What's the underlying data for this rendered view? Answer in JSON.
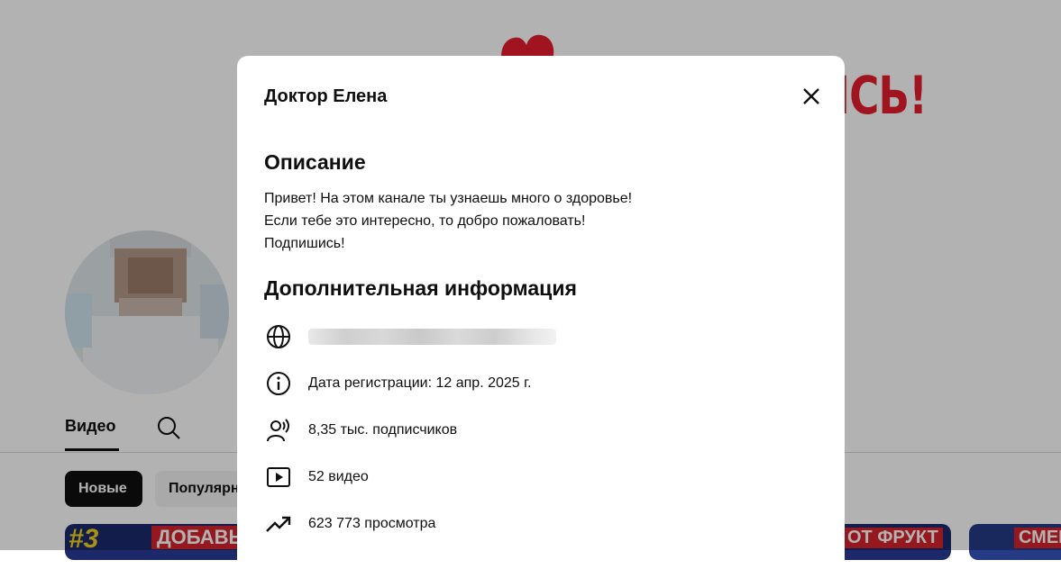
{
  "channel": {
    "banner_text": "ИСЬ!",
    "tabs": {
      "videos": "Видео"
    },
    "chips": {
      "new": "Новые",
      "popular": "Популярные"
    },
    "thumbnails": [
      {
        "badge": "#3",
        "title": "ДОБАВЬТЕ"
      },
      {
        "title": "ОТ ФРУКТ"
      },
      {
        "title": "СМЕШ"
      }
    ]
  },
  "modal": {
    "title": "Доктор Елена",
    "description_heading": "Описание",
    "description_lines": [
      "Привет! На этом канале ты узнаешь много о здоровье!",
      "Если тебе это интересно, то добро пожаловать!",
      "Подпишись!"
    ],
    "info_heading": "Дополнительная информация",
    "info": {
      "registration": "Дата регистрации: 12 апр. 2025 г.",
      "subscribers": "8,35 тыс. подписчиков",
      "videos": "52 видео",
      "views": "623 773 просмотра"
    },
    "icons": {
      "close": "close-icon",
      "link": "globe-icon",
      "registration": "info-icon",
      "subscribers": "person-signal-icon",
      "videos": "play-square-icon",
      "views": "trending-up-icon"
    }
  },
  "colors": {
    "accent": "#e41e2b",
    "overlay": "rgba(0,0,0,0.3)",
    "text": "#0f0f0f"
  }
}
